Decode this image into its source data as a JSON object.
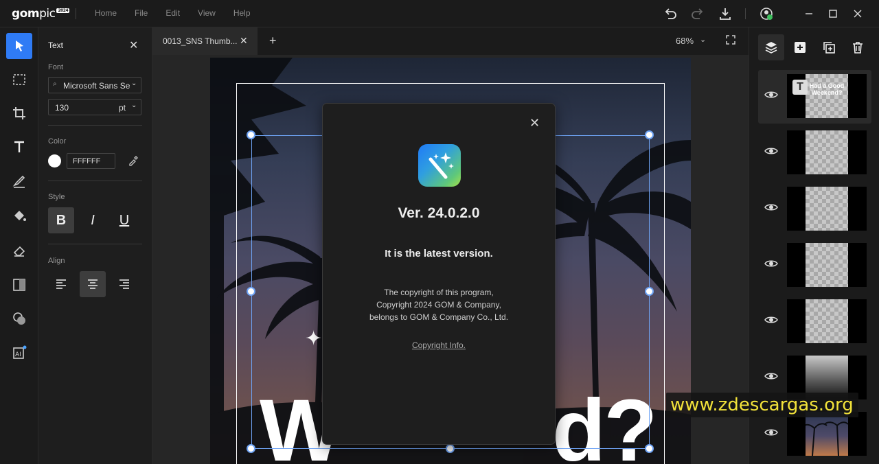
{
  "app": {
    "logo_main": "gom",
    "logo_sub": "pic",
    "logo_badge": "2024",
    "menu": [
      "Home",
      "File",
      "Edit",
      "View",
      "Help"
    ]
  },
  "text_panel": {
    "title": "Text",
    "font_label": "Font",
    "font_value": "Microsoft Sans Se",
    "size_value": "130",
    "size_unit": "pt",
    "color_label": "Color",
    "color_hex": "FFFFFF",
    "style_label": "Style",
    "style_buttons": [
      "B",
      "I",
      "U"
    ],
    "align_label": "Align"
  },
  "tabs": {
    "active_tab": "0013_SNS Thumb...",
    "zoom": "68%"
  },
  "canvas": {
    "big_text_left": "W",
    "big_text_right": "d?"
  },
  "dialog": {
    "version": "Ver. 24.0.2.0",
    "status": "It is the latest version.",
    "copyright_line1": "The copyright of this program,",
    "copyright_line2": "Copyright 2024 GOM & Company,",
    "copyright_line3": "belongs to GOM & Company Co., Ltd.",
    "copyright_link": "Copyright Info."
  },
  "layers": {
    "text_layer_caption": "Had a Good Weekend?"
  },
  "watermark": "www.zdescargas.org",
  "colors": {
    "accent": "#2f7bf5",
    "selection": "#6fa4f5",
    "watermark_text": "#f2e23a"
  }
}
